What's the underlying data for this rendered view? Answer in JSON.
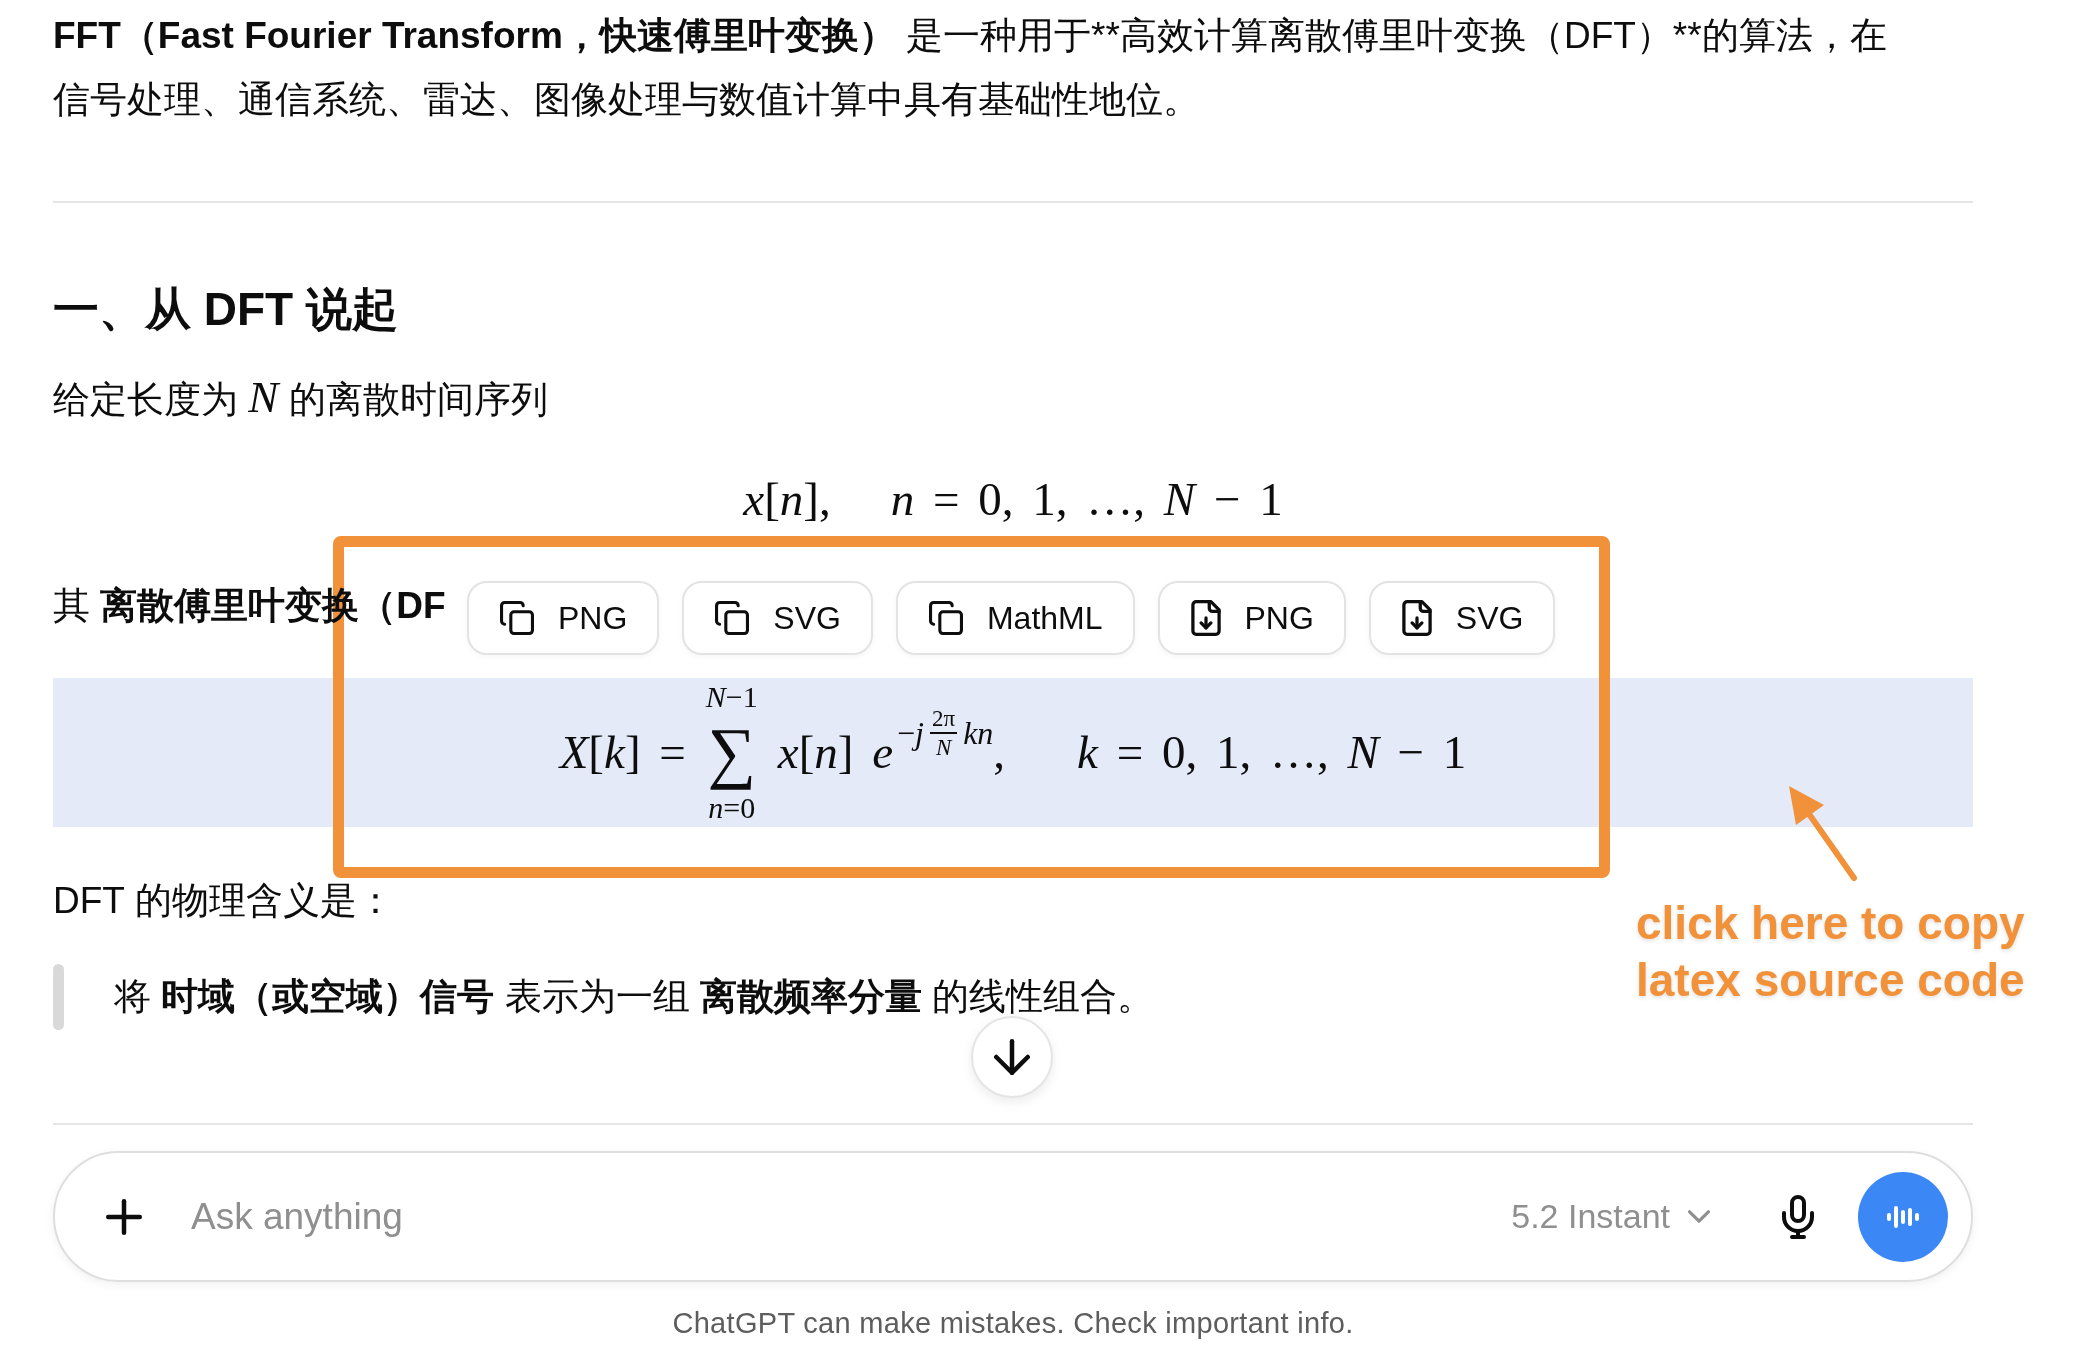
{
  "intro": {
    "bold_lead": "FFT（Fast Fourier Transform，快速傅里叶变换）",
    "text": " 是一种用于**高效计算离散傅里叶变换（DFT）**的算法，在信号处理、通信系统、雷达、图像处理与数值计算中具有基础性地位。"
  },
  "section_heading": "一、从 DFT 说起",
  "sequence_intro": "给定长度为 *N* 的离散时间序列",
  "sequence_formula": {
    "term": "*x*[*n*],",
    "range": "*n* = 0, 1, …, *N* − 1"
  },
  "dft_intro": "其 **离散傅里叶变换（DF**",
  "dft_formula": {
    "lhs": "*X*[*k*] =",
    "operator": "∑",
    "upper_limit": "*N*−1",
    "lower_limit": "*n*=0",
    "term": "*x*[*n*] *e*",
    "exponent": "−*j*",
    "fraction_numerator": "2π",
    "fraction_denominator": "*N*",
    "exponent_tail": "*kn*",
    "separator": ",",
    "range": "*k* = 0, 1, …, *N* − 1"
  },
  "formula_toolbar": [
    {
      "kind": "copy",
      "label": "PNG"
    },
    {
      "kind": "copy",
      "label": "SVG"
    },
    {
      "kind": "copy",
      "label": "MathML"
    },
    {
      "kind": "download",
      "label": "PNG"
    },
    {
      "kind": "download",
      "label": "SVG"
    }
  ],
  "meaning_intro": "DFT 的物理含义是：",
  "quote": "将 **时域（或空域）信号** 表示为一组 **离散频率分量** 的线性组合。",
  "composer": {
    "placeholder": "Ask anything",
    "model": "5.2 Instant"
  },
  "disclaimer": "ChatGPT can make mistakes. Check important info.",
  "annotation": {
    "text": "click here to copy latex source code"
  }
}
